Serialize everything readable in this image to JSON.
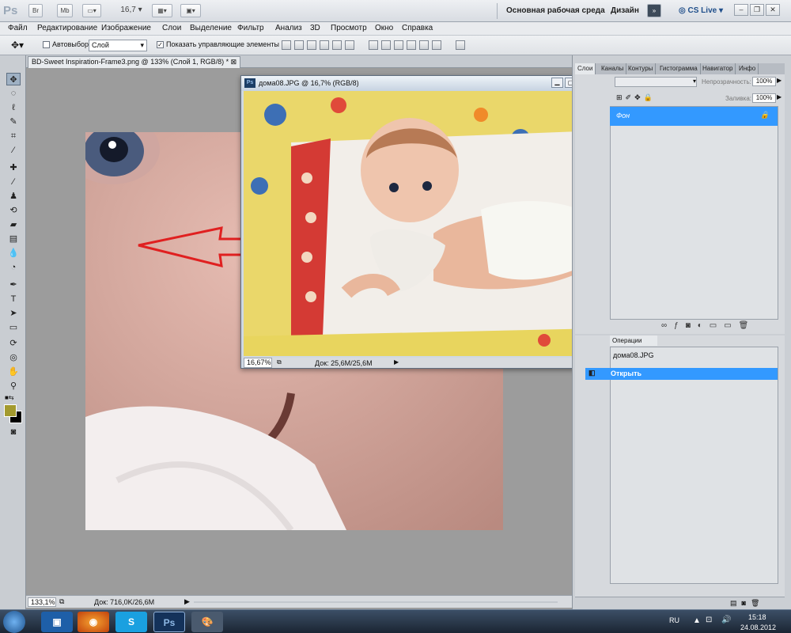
{
  "appbar": {
    "logo": "Ps",
    "bridge_label": "Br",
    "minibridge_label": "Mb",
    "zoom_value": "16,7",
    "workspace_label": "Основная рабочая среда",
    "design_label": "Дизайн",
    "cslive_label": "CS Live"
  },
  "menu": {
    "items": [
      "Файл",
      "Редактирование",
      "Изображение",
      "Слои",
      "Выделение",
      "Фильтр",
      "Анализ",
      "3D",
      "Просмотр",
      "Окно",
      "Справка"
    ]
  },
  "options": {
    "autoselect_label": "Автовыбор:",
    "autoselect_value": "Слой",
    "show_controls_label": "Показать управляющие элементы"
  },
  "document": {
    "tab_title": "BD-Sweet Inspiration-Frame3.png @ 133% (Слой 1, RGB/8) *",
    "zoom": "133,1%",
    "doc_size": "Док: 716,0K/26,6M"
  },
  "float_window": {
    "title": "дома08.JPG @ 16,7% (RGB/8)",
    "zoom": "16,67%",
    "doc_size": "Док: 25,6M/25,6M"
  },
  "panels": {
    "tabs": [
      "Слои",
      "Каналы",
      "Контуры",
      "Гистограмма",
      "Навигатор",
      "Инфо"
    ],
    "opacity_label": "Непрозрачность:",
    "opacity_value": "100%",
    "fill_label": "Заливка:",
    "fill_value": "100%",
    "layer_name": "Фон",
    "actions_tab": "Операции",
    "history_doc": "дома08.JPG",
    "history_item": "Открыть"
  },
  "taskbar": {
    "lang": "RU",
    "time": "15:18",
    "date": "24.08.2012"
  },
  "colors": {
    "foreground": "#a39a2e",
    "background": "#000000",
    "selection": "#3399ff",
    "arrow": "#e02020"
  }
}
